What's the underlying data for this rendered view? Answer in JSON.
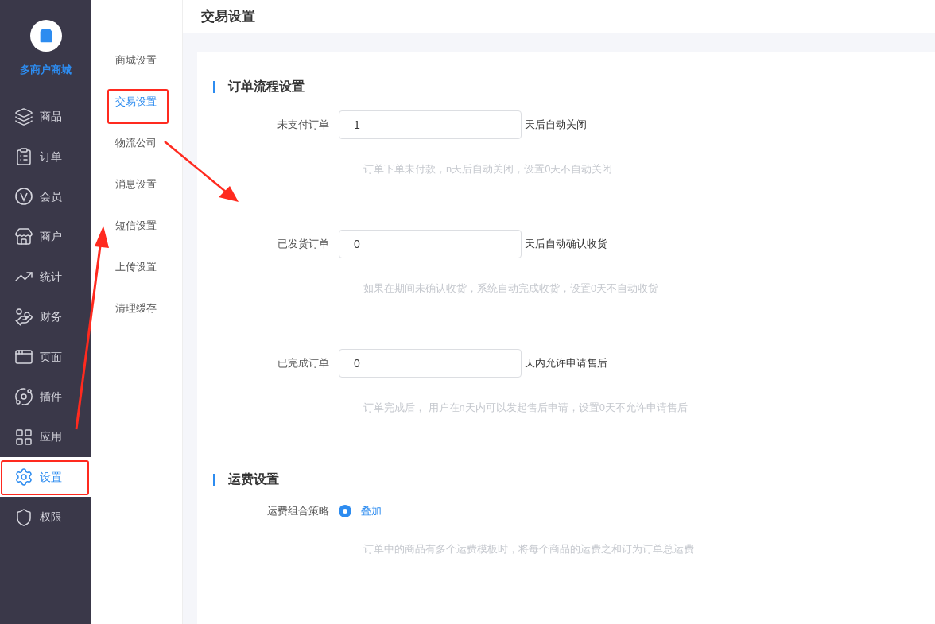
{
  "brand": {
    "name": "多商户商城"
  },
  "sidebar": {
    "items": [
      {
        "label": "商品",
        "selected": false
      },
      {
        "label": "订单",
        "selected": false
      },
      {
        "label": "会员",
        "selected": false
      },
      {
        "label": "商户",
        "selected": false
      },
      {
        "label": "统计",
        "selected": false
      },
      {
        "label": "财务",
        "selected": false
      },
      {
        "label": "页面",
        "selected": false
      },
      {
        "label": "插件",
        "selected": false
      },
      {
        "label": "应用",
        "selected": false
      },
      {
        "label": "设置",
        "selected": true
      },
      {
        "label": "权限",
        "selected": false
      }
    ]
  },
  "submenu": {
    "items": [
      {
        "label": "商城设置",
        "selected": false
      },
      {
        "label": "交易设置",
        "selected": true
      },
      {
        "label": "物流公司",
        "selected": false
      },
      {
        "label": "消息设置",
        "selected": false
      },
      {
        "label": "短信设置",
        "selected": false
      },
      {
        "label": "上传设置",
        "selected": false
      },
      {
        "label": "清理缓存",
        "selected": false
      }
    ]
  },
  "page": {
    "title": "交易设置"
  },
  "sections": [
    {
      "title": "订单流程设置",
      "fields": [
        {
          "kind": "input",
          "label": "未支付订单",
          "value": "1",
          "suffix": "天后自动关闭",
          "hint": "订单下单未付款，n天后自动关闭，设置0天不自动关闭"
        },
        {
          "kind": "input",
          "label": "已发货订单",
          "value": "0",
          "suffix": "天后自动确认收货",
          "hint": "如果在期间未确认收货，系统自动完成收货，设置0天不自动收货"
        },
        {
          "kind": "input",
          "label": "已完成订单",
          "value": "0",
          "suffix": "天内允许申请售后",
          "hint": "订单完成后， 用户在n天内可以发起售后申请，设置0天不允许申请售后"
        }
      ]
    },
    {
      "title": "运费设置",
      "fields": [
        {
          "kind": "radio",
          "label": "运费组合策略",
          "options": [
            {
              "label": "叠加",
              "selected": true
            }
          ],
          "hint": "订单中的商品有多个运费模板时，将每个商品的运费之和订为订单总运费"
        }
      ]
    }
  ]
}
